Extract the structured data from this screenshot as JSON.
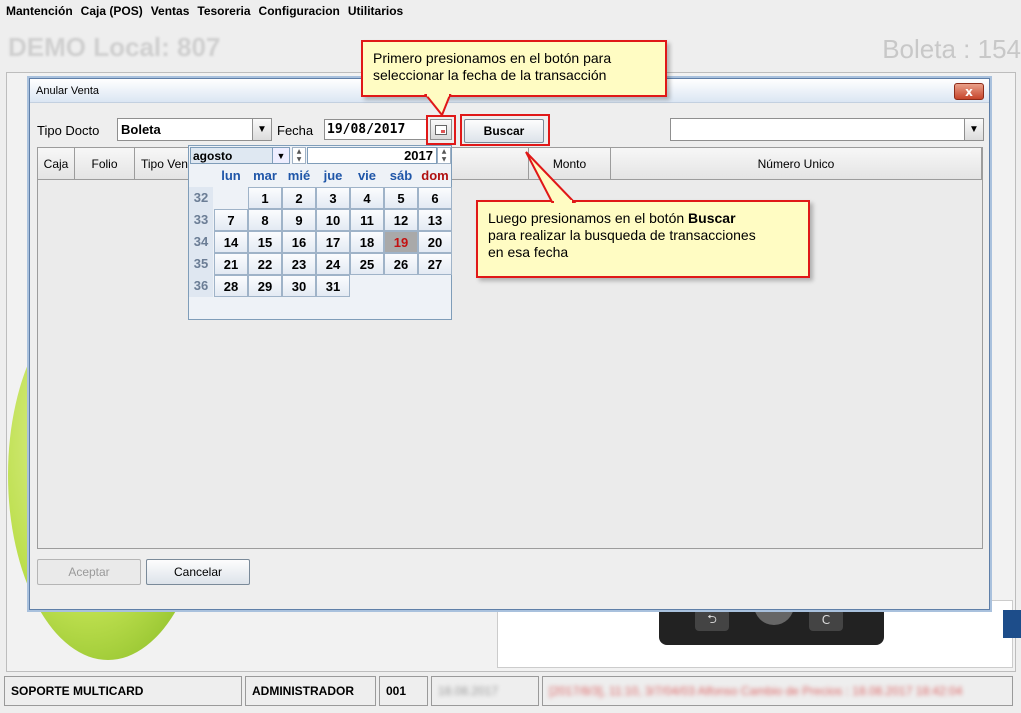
{
  "menu": [
    "Mantención",
    "Caja (POS)",
    "Ventas",
    "Tesoreria",
    "Configuracion",
    "Utilitarios"
  ],
  "background": {
    "local_title": "DEMO Local: 807",
    "doc_title": "Boleta : 154"
  },
  "dialog": {
    "title": "Anular Venta",
    "close_label": "x",
    "tipo_docto_label": "Tipo Docto",
    "tipo_docto_value": "Boleta",
    "fecha_label": "Fecha",
    "fecha_value": "19/08/2017",
    "buscar_label": "Buscar",
    "right_combo_value": "",
    "columns": [
      "Caja",
      "Folio",
      "Tipo Ven",
      "Monto",
      "Número Unico"
    ],
    "aceptar_label": "Aceptar",
    "cancelar_label": "Cancelar"
  },
  "calendar": {
    "month": "agosto",
    "year": "2017",
    "days_of_week": [
      "lun",
      "mar",
      "mié",
      "jue",
      "vie",
      "sáb",
      "dom"
    ],
    "weeks": [
      {
        "num": "32",
        "days": [
          "",
          "1",
          "2",
          "3",
          "4",
          "5",
          "6"
        ]
      },
      {
        "num": "33",
        "days": [
          "7",
          "8",
          "9",
          "10",
          "11",
          "12",
          "13"
        ]
      },
      {
        "num": "34",
        "days": [
          "14",
          "15",
          "16",
          "17",
          "18",
          "19",
          "20"
        ]
      },
      {
        "num": "35",
        "days": [
          "21",
          "22",
          "23",
          "24",
          "25",
          "26",
          "27"
        ]
      },
      {
        "num": "36",
        "days": [
          "28",
          "29",
          "30",
          "31",
          "",
          "",
          ""
        ]
      }
    ],
    "selected_day": "19"
  },
  "callouts": {
    "first_line1": "Primero presionamos en el botón para",
    "first_line2": "seleccionar la fecha de la transacción",
    "second_pre": "Luego presionamos en el botón ",
    "second_bold": "Buscar",
    "second_line2": "para realizar la busqueda de transacciones",
    "second_line3": "en esa fecha"
  },
  "statusbar": {
    "company": "SOPORTE MULTICARD",
    "user": "ADMINISTRADOR",
    "terminal": "001",
    "date_blurred": "18.08.2017",
    "message_blurred": "[2017/8/3], 11:10, 3/7/04/03 Alfonso Cambio de Precios : 18.08.2017 18:42:04"
  },
  "colors": {
    "callout_bg": "#fffcc3",
    "highlight_red": "#e01818",
    "weekday_blue": "#1f56a8",
    "sunday_red": "#b01010"
  }
}
